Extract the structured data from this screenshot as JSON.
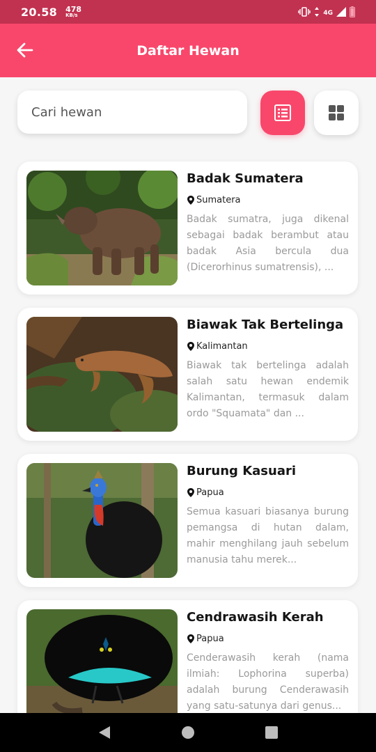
{
  "status_bar": {
    "time": "20.58",
    "speed_value": "478",
    "speed_unit": "KB/s",
    "network": "4G"
  },
  "header": {
    "title": "Daftar Hewan"
  },
  "search": {
    "placeholder": "Cari hewan"
  },
  "colors": {
    "primary": "#f8476b",
    "status_bar": "#c13150",
    "description": "#9a9a9a"
  },
  "animals": [
    {
      "name": "Badak Sumatera",
      "location": "Sumatera",
      "description": "Badak sumatra, juga dikenal sebagai badak berambut atau badak Asia bercula dua (Dicerorhinus sumatrensis), ..."
    },
    {
      "name": "Biawak Tak Bertelinga",
      "location": "Kalimantan",
      "description": "Biawak tak bertelinga adalah salah satu hewan endemik Kalimantan, termasuk dalam ordo \"Squamata\" dan ..."
    },
    {
      "name": "Burung Kasuari",
      "location": "Papua",
      "description": "Semua kasuari biasanya burung pemangsa di hutan dalam, mahir menghilang jauh sebelum manusia tahu merek..."
    },
    {
      "name": "Cendrawasih Kerah",
      "location": "Papua",
      "description": "Cenderawasih kerah (nama ilmiah: Lophorina superba) adalah burung Cenderawasih yang satu-satunya dari genus..."
    }
  ]
}
